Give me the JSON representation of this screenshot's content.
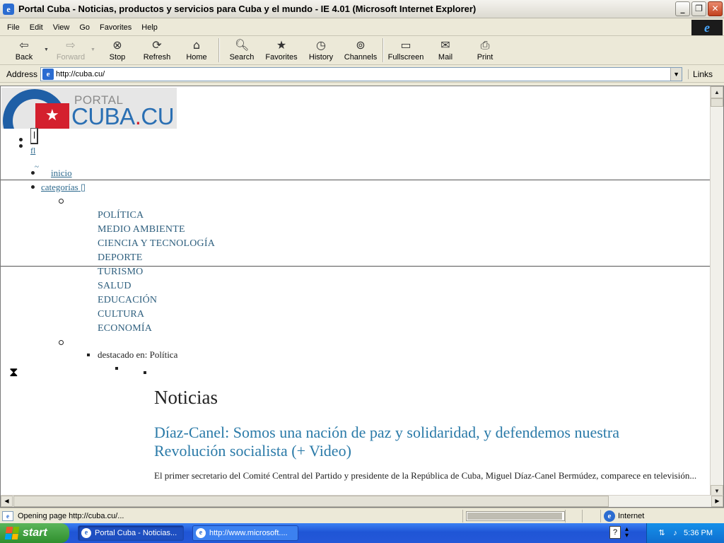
{
  "window": {
    "title": "Portal Cuba - Noticias, productos y servicios para Cuba y el mundo - IE 4.01 (Microsoft Internet Explorer)",
    "controls": [
      "_",
      "❐",
      "✕"
    ]
  },
  "menu": [
    "File",
    "Edit",
    "View",
    "Go",
    "Favorites",
    "Help"
  ],
  "toolbar": {
    "back": "Back",
    "forward": "Forward",
    "stop": "Stop",
    "refresh": "Refresh",
    "home": "Home",
    "search": "Search",
    "favorites": "Favorites",
    "history": "History",
    "channels": "Channels",
    "fullscreen": "Fullscreen",
    "mail": "Mail",
    "print": "Print"
  },
  "address": {
    "label": "Address",
    "url": "http://cuba.cu/",
    "links": "Links"
  },
  "page": {
    "logo": {
      "top": "PORTAL",
      "bottom": "CUBA",
      "dot": ".",
      "suffix": "CU"
    },
    "nav_glyph": "fl",
    "tilde": "~",
    "nav_inicio": "inicio",
    "nav_categorias": "categorías",
    "nav_categorias_glyph": "▯",
    "categories": [
      "POLÍTICA",
      "MEDIO AMBIENTE",
      "CIENCIA Y TECNOLOGÍA",
      "DEPORTE",
      "TURISMO",
      "SALUD",
      "EDUCACIÓN",
      "CULTURA",
      "ECONOMÍA"
    ],
    "destacado": "destacado en: Política",
    "section_heading": "Noticias",
    "article_title": "Díaz-Canel: Somos una nación de paz y solidaridad, y defendemos nuestra Revolución socialista (+ Video)",
    "article_excerpt": "El primer secretario del Comité Central del Partido y presidente de la República de Cuba, Miguel Díaz-Canel Bermúdez, comparece en televisión..."
  },
  "status": {
    "text": "Opening page http://cuba.cu/...",
    "zone": "Internet",
    "progress": 0.97
  },
  "taskbar": {
    "start": "start",
    "tasks": [
      "Portal Cuba - Noticias...",
      "http://www.microsoft...."
    ],
    "clock": "5:36 PM",
    "help": "?"
  }
}
